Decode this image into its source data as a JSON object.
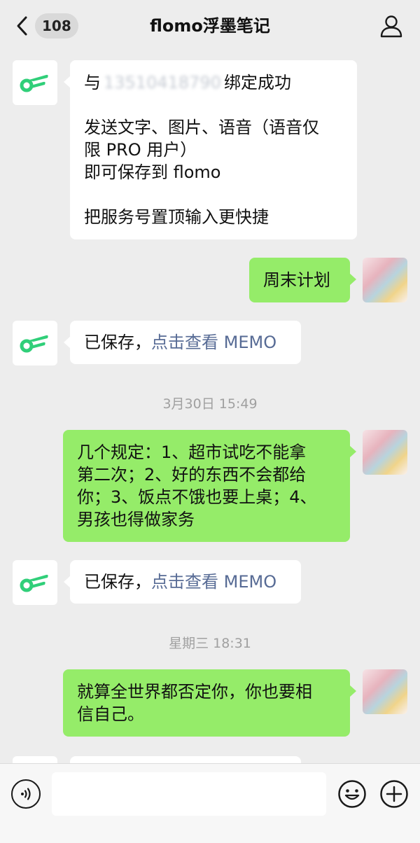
{
  "header": {
    "unread_count": "108",
    "title": "flomo浮墨笔记"
  },
  "messages": [
    {
      "from": "bot",
      "line1_prefix": "与",
      "line1_blurred": "13510418790",
      "line1_suffix": "绑定成功",
      "line2": "发送文字、图片、语音（语音仅",
      "line3": "限 PRO 用户）",
      "line4": "即可保存到 flomo",
      "line5": "把服务号置顶输入更快捷"
    },
    {
      "from": "user",
      "text": "周末计划"
    },
    {
      "from": "bot",
      "prefix": "已保存，",
      "link": "点击查看 MEMO"
    },
    {
      "timestamp": "3月30日 15:49"
    },
    {
      "from": "user",
      "lines": [
        "几个规定：1、超市试吃不能拿",
        "第二次；2、好的东西不会都给",
        "你；3、饭点不饿也要上桌；4、",
        "男孩也得做家务"
      ]
    },
    {
      "from": "bot",
      "prefix": "已保存，",
      "link": "点击查看 MEMO"
    },
    {
      "timestamp": "星期三 18:31"
    },
    {
      "from": "user",
      "lines": [
        "就算全世界都否定你，你也要相",
        "信自己。"
      ]
    }
  ],
  "input": {
    "placeholder": ""
  },
  "colors": {
    "background": "#ededed",
    "user_bubble": "#95ec69",
    "bot_bubble": "#ffffff",
    "link": "#576b95",
    "flomo_green": "#30cf79"
  },
  "icons": {
    "back": "chevron-left-icon",
    "profile": "person-icon",
    "voice": "voice-icon",
    "emoji": "emoji-icon",
    "plus": "plus-circle-icon",
    "bot_avatar": "flomo-logo-icon"
  }
}
